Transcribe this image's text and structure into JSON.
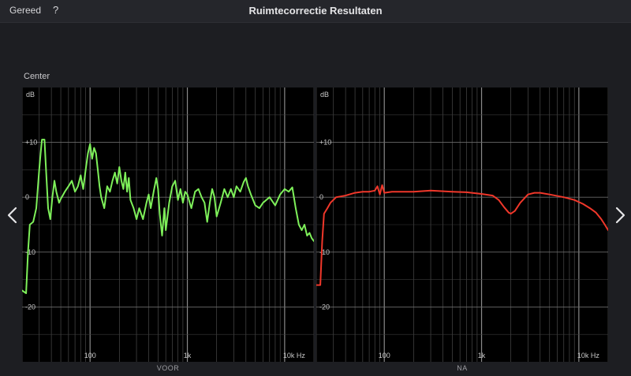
{
  "toolbar": {
    "done_label": "Gereed",
    "help_label": "?",
    "title": "Ruimtecorrectie Resultaten"
  },
  "channel_label": "Center",
  "icons": {
    "prev": "chevron-left-icon",
    "next": "chevron-right-icon"
  },
  "colors": {
    "before_curve": "#7ef05a",
    "after_curve": "#f0372a",
    "grid": "#5a5a5a"
  },
  "chart_data": [
    {
      "type": "line",
      "name": "before",
      "panel_label": "VOOR",
      "xscale": "log",
      "xlim": [
        20,
        20000
      ],
      "ylim": [
        -30,
        20
      ],
      "ylabel": "dB",
      "y_ticks": [
        {
          "value": 10,
          "label": "+10"
        },
        {
          "value": 0,
          "label": "0"
        },
        {
          "value": -10,
          "label": "-10"
        },
        {
          "value": -20,
          "label": "-20"
        }
      ],
      "x_ticks": [
        {
          "value": 100,
          "label": "100"
        },
        {
          "value": 1000,
          "label": "1k"
        },
        {
          "value": 10000,
          "label": "10k Hz"
        }
      ],
      "grid": true,
      "color": "#7ef05a",
      "points": [
        [
          20,
          -17
        ],
        [
          22,
          -17.5
        ],
        [
          23,
          -10
        ],
        [
          24,
          -5
        ],
        [
          26,
          -4.5
        ],
        [
          28,
          -2
        ],
        [
          30,
          5
        ],
        [
          31,
          8
        ],
        [
          32,
          10.5
        ],
        [
          34,
          10.5
        ],
        [
          35,
          6
        ],
        [
          37,
          -2
        ],
        [
          39,
          -4
        ],
        [
          41,
          0
        ],
        [
          43,
          3
        ],
        [
          45,
          1
        ],
        [
          48,
          -1
        ],
        [
          50,
          -0.3
        ],
        [
          55,
          1
        ],
        [
          60,
          2
        ],
        [
          65,
          3
        ],
        [
          70,
          1
        ],
        [
          75,
          2
        ],
        [
          80,
          4
        ],
        [
          85,
          1.5
        ],
        [
          90,
          5
        ],
        [
          95,
          8
        ],
        [
          100,
          9.7
        ],
        [
          105,
          7
        ],
        [
          110,
          9
        ],
        [
          115,
          8
        ],
        [
          120,
          5
        ],
        [
          125,
          2
        ],
        [
          130,
          0
        ],
        [
          140,
          -2
        ],
        [
          150,
          2
        ],
        [
          160,
          1
        ],
        [
          170,
          3
        ],
        [
          180,
          4.5
        ],
        [
          190,
          2.5
        ],
        [
          200,
          5.5
        ],
        [
          210,
          3
        ],
        [
          220,
          1.5
        ],
        [
          230,
          4.5
        ],
        [
          240,
          1
        ],
        [
          250,
          3.5
        ],
        [
          260,
          -0.5
        ],
        [
          280,
          -2
        ],
        [
          300,
          -4
        ],
        [
          320,
          -2
        ],
        [
          350,
          -4
        ],
        [
          380,
          -1
        ],
        [
          400,
          0.5
        ],
        [
          420,
          -2
        ],
        [
          450,
          1
        ],
        [
          480,
          3.5
        ],
        [
          500,
          1.5
        ],
        [
          520,
          -3
        ],
        [
          550,
          -7
        ],
        [
          580,
          -2
        ],
        [
          600,
          -6
        ],
        [
          650,
          -1
        ],
        [
          700,
          2
        ],
        [
          750,
          3
        ],
        [
          800,
          -0.5
        ],
        [
          850,
          1.5
        ],
        [
          900,
          -1
        ],
        [
          950,
          1
        ],
        [
          1000,
          0.5
        ],
        [
          1100,
          -2
        ],
        [
          1200,
          1
        ],
        [
          1300,
          1.5
        ],
        [
          1400,
          0
        ],
        [
          1500,
          -1
        ],
        [
          1600,
          -4.5
        ],
        [
          1700,
          -1
        ],
        [
          1800,
          1.5
        ],
        [
          1900,
          0
        ],
        [
          2000,
          -3.5
        ],
        [
          2200,
          -1
        ],
        [
          2400,
          1.5
        ],
        [
          2600,
          0
        ],
        [
          2800,
          1.5
        ],
        [
          3000,
          0
        ],
        [
          3200,
          2
        ],
        [
          3500,
          1
        ],
        [
          3800,
          2.8
        ],
        [
          4000,
          3.5
        ],
        [
          4200,
          2
        ],
        [
          4500,
          0.5
        ],
        [
          5000,
          -1.5
        ],
        [
          5500,
          -2
        ],
        [
          6000,
          -1
        ],
        [
          7000,
          0
        ],
        [
          8000,
          -1.5
        ],
        [
          9000,
          0.5
        ],
        [
          10000,
          1.5
        ],
        [
          11000,
          1
        ],
        [
          12000,
          1.8
        ],
        [
          13000,
          -2
        ],
        [
          14000,
          -5
        ],
        [
          15000,
          -6
        ],
        [
          16000,
          -5
        ],
        [
          17000,
          -7
        ],
        [
          18000,
          -6.5
        ],
        [
          19000,
          -7.5
        ],
        [
          20000,
          -8
        ]
      ]
    },
    {
      "type": "line",
      "name": "after",
      "panel_label": "NA",
      "xscale": "log",
      "xlim": [
        20,
        20000
      ],
      "ylim": [
        -30,
        20
      ],
      "ylabel": "dB",
      "y_ticks": [
        {
          "value": 10,
          "label": "+10"
        },
        {
          "value": 0,
          "label": "0"
        },
        {
          "value": -10,
          "label": "-10"
        },
        {
          "value": -20,
          "label": "-20"
        }
      ],
      "x_ticks": [
        {
          "value": 100,
          "label": "100"
        },
        {
          "value": 1000,
          "label": "1k"
        },
        {
          "value": 10000,
          "label": "10k Hz"
        }
      ],
      "grid": true,
      "color": "#f0372a",
      "points": [
        [
          20,
          -16
        ],
        [
          22,
          -16
        ],
        [
          23,
          -8
        ],
        [
          24,
          -3
        ],
        [
          26,
          -2
        ],
        [
          28,
          -1
        ],
        [
          32,
          0
        ],
        [
          40,
          0.3
        ],
        [
          50,
          0.8
        ],
        [
          60,
          1
        ],
        [
          70,
          1
        ],
        [
          80,
          1.2
        ],
        [
          85,
          2
        ],
        [
          90,
          0.5
        ],
        [
          95,
          2.2
        ],
        [
          100,
          0.8
        ],
        [
          120,
          1
        ],
        [
          150,
          1
        ],
        [
          200,
          1
        ],
        [
          300,
          1.2
        ],
        [
          500,
          1
        ],
        [
          700,
          0.9
        ],
        [
          1000,
          0.6
        ],
        [
          1300,
          0.3
        ],
        [
          1500,
          -0.5
        ],
        [
          1700,
          -1.8
        ],
        [
          1900,
          -2.8
        ],
        [
          2000,
          -3
        ],
        [
          2200,
          -2.5
        ],
        [
          2500,
          -1
        ],
        [
          3000,
          0.5
        ],
        [
          3500,
          0.8
        ],
        [
          4000,
          0.8
        ],
        [
          5000,
          0.5
        ],
        [
          7000,
          0
        ],
        [
          9000,
          -0.5
        ],
        [
          11000,
          -1.2
        ],
        [
          13000,
          -2
        ],
        [
          15000,
          -2.8
        ],
        [
          17000,
          -4
        ],
        [
          18500,
          -5
        ],
        [
          20000,
          -6
        ]
      ]
    }
  ]
}
